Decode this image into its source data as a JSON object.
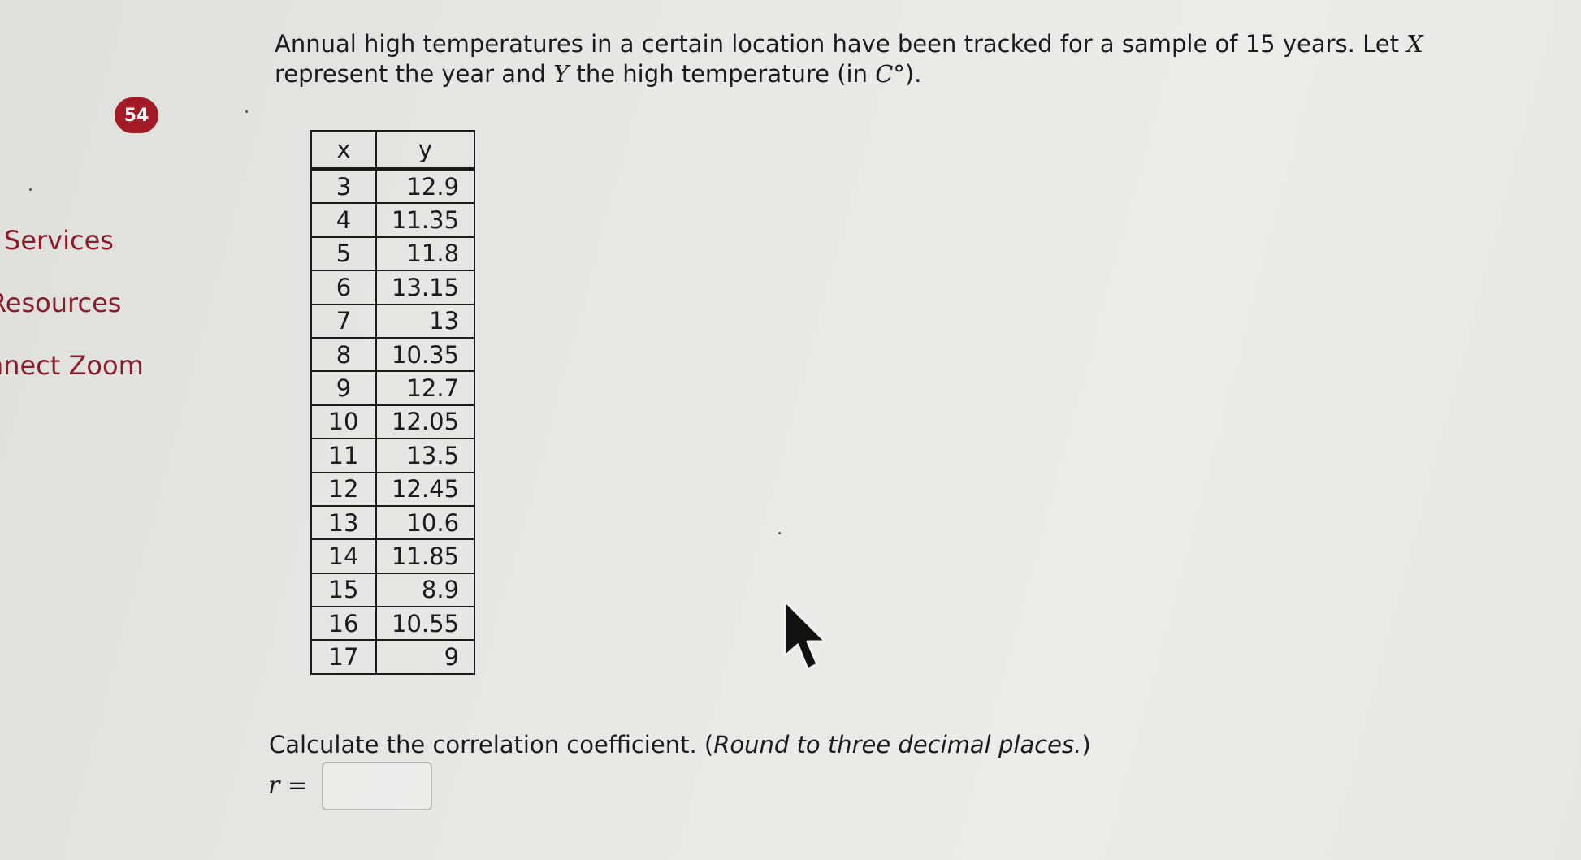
{
  "sidebar": {
    "badge": "54",
    "items": [
      {
        "label": "Services"
      },
      {
        "label": "Resources"
      },
      {
        "label": "Connect Zoom"
      }
    ]
  },
  "question": {
    "text_part1": "Annual high temperatures in a certain location have been tracked for a sample of 15 years. Let ",
    "var_x": "X",
    "text_part2": "represent the year and ",
    "var_y": "Y",
    "text_part3": " the high temperature (in ",
    "var_c": "C°",
    "text_part4": ")."
  },
  "table": {
    "headers": [
      "x",
      "y"
    ],
    "rows": [
      [
        "3",
        "12.9"
      ],
      [
        "4",
        "11.35"
      ],
      [
        "5",
        "11.8"
      ],
      [
        "6",
        "13.15"
      ],
      [
        "7",
        "13"
      ],
      [
        "8",
        "10.35"
      ],
      [
        "9",
        "12.7"
      ],
      [
        "10",
        "12.05"
      ],
      [
        "11",
        "13.5"
      ],
      [
        "12",
        "12.45"
      ],
      [
        "13",
        "10.6"
      ],
      [
        "14",
        "11.85"
      ],
      [
        "15",
        "8.9"
      ],
      [
        "16",
        "10.55"
      ],
      [
        "17",
        "9"
      ]
    ]
  },
  "instruction": {
    "main": "Calculate the correlation coefficient. (",
    "hint": "Round to three decimal places.",
    "close": ")"
  },
  "answer": {
    "label": "r =",
    "value": ""
  },
  "colors": {
    "accent": "#8b1c2b",
    "badge": "#a11a26"
  }
}
